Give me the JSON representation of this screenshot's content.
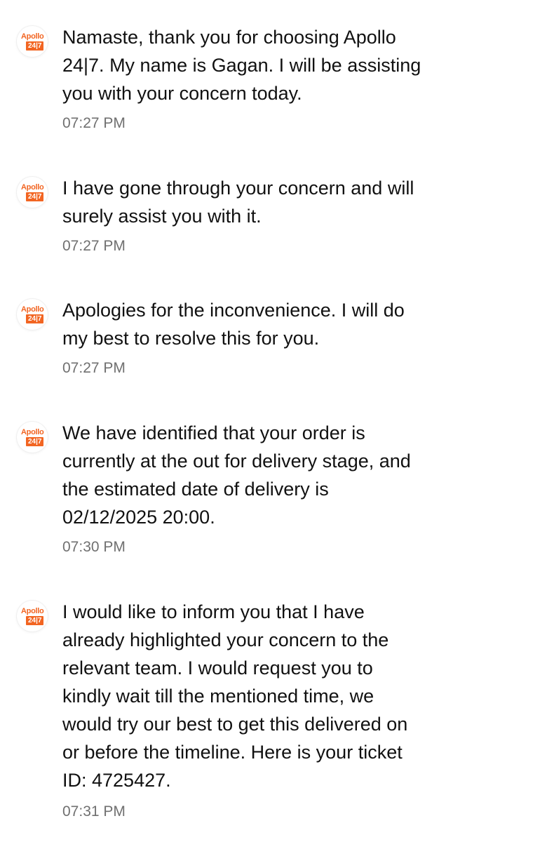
{
  "avatar": {
    "brand_top": "Apollo",
    "brand_badge": "24|7",
    "brand_color": "#f26522"
  },
  "messages": [
    {
      "lines": [
        "Namaste, thank you for choosing Apollo",
        "24|7. My name is Gagan. I will be assisting",
        "you with your concern today."
      ],
      "time": "07:27 PM"
    },
    {
      "lines": [
        "I have gone through your concern and will",
        "surely assist you with it."
      ],
      "time": "07:27 PM"
    },
    {
      "lines": [
        "Apologies for the inconvenience. I will do",
        "my best to resolve this for you."
      ],
      "time": "07:27 PM"
    },
    {
      "lines": [
        "We have identified that your order is",
        "currently at the out for delivery stage, and",
        "the estimated date of delivery is",
        "02/12/2025 20:00."
      ],
      "time": "07:30 PM"
    },
    {
      "lines": [
        "I would like to inform you that I have",
        "already highlighted your concern to the",
        "relevant team. I would request you to",
        "kindly wait till the mentioned time, we",
        "would try our best to get this delivered on",
        "or before the timeline. Here is your ticket",
        "ID: 4725427."
      ],
      "time": "07:31 PM"
    }
  ]
}
